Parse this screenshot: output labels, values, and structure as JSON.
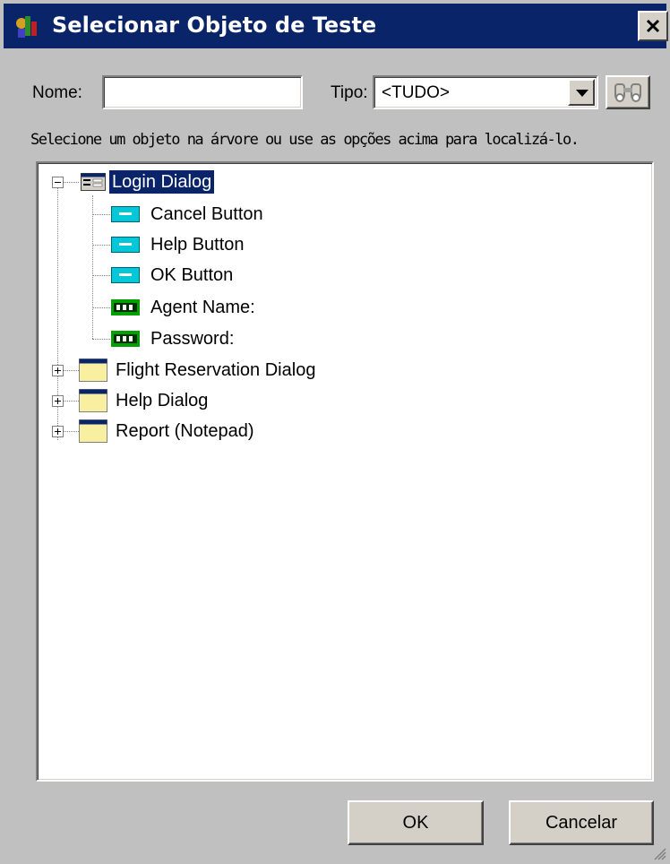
{
  "window": {
    "title": "Selecionar Objeto de Teste"
  },
  "filters": {
    "name_label": "Nome:",
    "name_value": "",
    "type_label": "Tipo:",
    "type_value": "<TUDO>"
  },
  "hint": "Selecione um objeto na árvore ou use as opções acima para localizá-lo.",
  "tree": {
    "root": {
      "label": "Login Dialog",
      "children": [
        {
          "label": "Cancel Button",
          "icon": "button-icon"
        },
        {
          "label": "Help Button",
          "icon": "button-icon"
        },
        {
          "label": "OK Button",
          "icon": "button-icon"
        },
        {
          "label": "Agent Name:",
          "icon": "static-text-icon"
        },
        {
          "label": "Password:",
          "icon": "static-text-icon"
        }
      ]
    },
    "siblings": [
      {
        "label": "Flight Reservation Dialog",
        "icon": "window-icon"
      },
      {
        "label": "Help Dialog",
        "icon": "window-icon"
      },
      {
        "label": "Report (Notepad)",
        "icon": "window-icon"
      }
    ]
  },
  "buttons": {
    "ok": "OK",
    "cancel": "Cancelar"
  },
  "colors": {
    "titlebar": "#0a246a",
    "face": "#c0c0c0",
    "selection": "#0a246a",
    "button_icon": "#00c8d8",
    "text_icon": "#00a000",
    "window_icon": "#f8f0a0"
  }
}
